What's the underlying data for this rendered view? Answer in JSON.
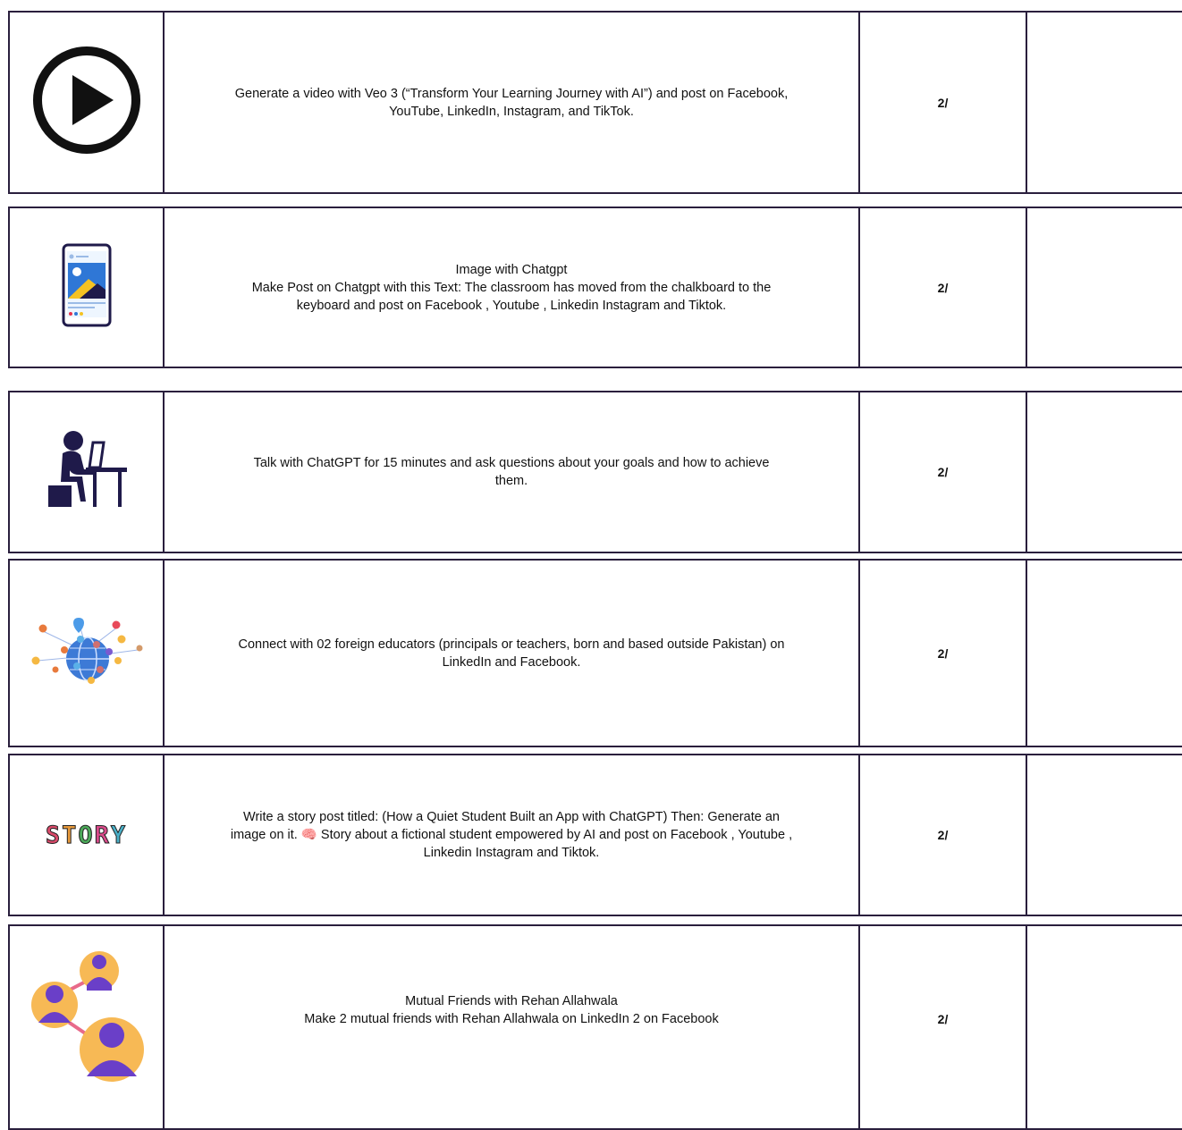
{
  "rows": [
    {
      "icon": "play-icon",
      "lines": [
        "Generate a video with Veo 3 (“Transform Your Learning Journey with AI”) and post on Facebook,",
        "YouTube, LinkedIn, Instagram, and TikTok."
      ],
      "score": "2/"
    },
    {
      "icon": "phone-image-post-icon",
      "lines": [
        "Image with Chatgpt",
        "Make Post on Chatgpt with this Text:  The classroom has moved from the chalkboard to the",
        "keyboard and post on Facebook , Youtube , Linkedin Instagram and Tiktok."
      ],
      "score": "2/"
    },
    {
      "icon": "person-at-laptop-icon",
      "lines": [
        "Talk with ChatGPT for 15 minutes and ask questions about your goals and how to achieve",
        "them."
      ],
      "score": "2/"
    },
    {
      "icon": "global-network-icon",
      "lines": [
        "Connect with 02 foreign educators (principals or teachers, born and based outside Pakistan) on",
        "LinkedIn and Facebook."
      ],
      "score": "2/"
    },
    {
      "icon": "story-icon",
      "icon_text": "STORY",
      "lines": [
        "Write a story post titled: (How a Quiet Student Built an App with ChatGPT) Then: Generate an",
        "image on it. 🧠 Story about a fictional student empowered by AI and post on Facebook , Youtube ,",
        "Linkedin Instagram and Tiktok."
      ],
      "score": "2/"
    },
    {
      "icon": "mutual-friends-icon",
      "lines": [
        "Mutual Friends with Rehan Allahwala",
        "Make 2 mutual friends with Rehan Allahwala on LinkedIn 2 on Facebook"
      ],
      "score": "2/"
    }
  ],
  "colors": {
    "border": "#2a1f3d",
    "accent_purple": "#6a3fc8",
    "accent_orange": "#f7b955",
    "dark_navy": "#1f1a4a"
  }
}
